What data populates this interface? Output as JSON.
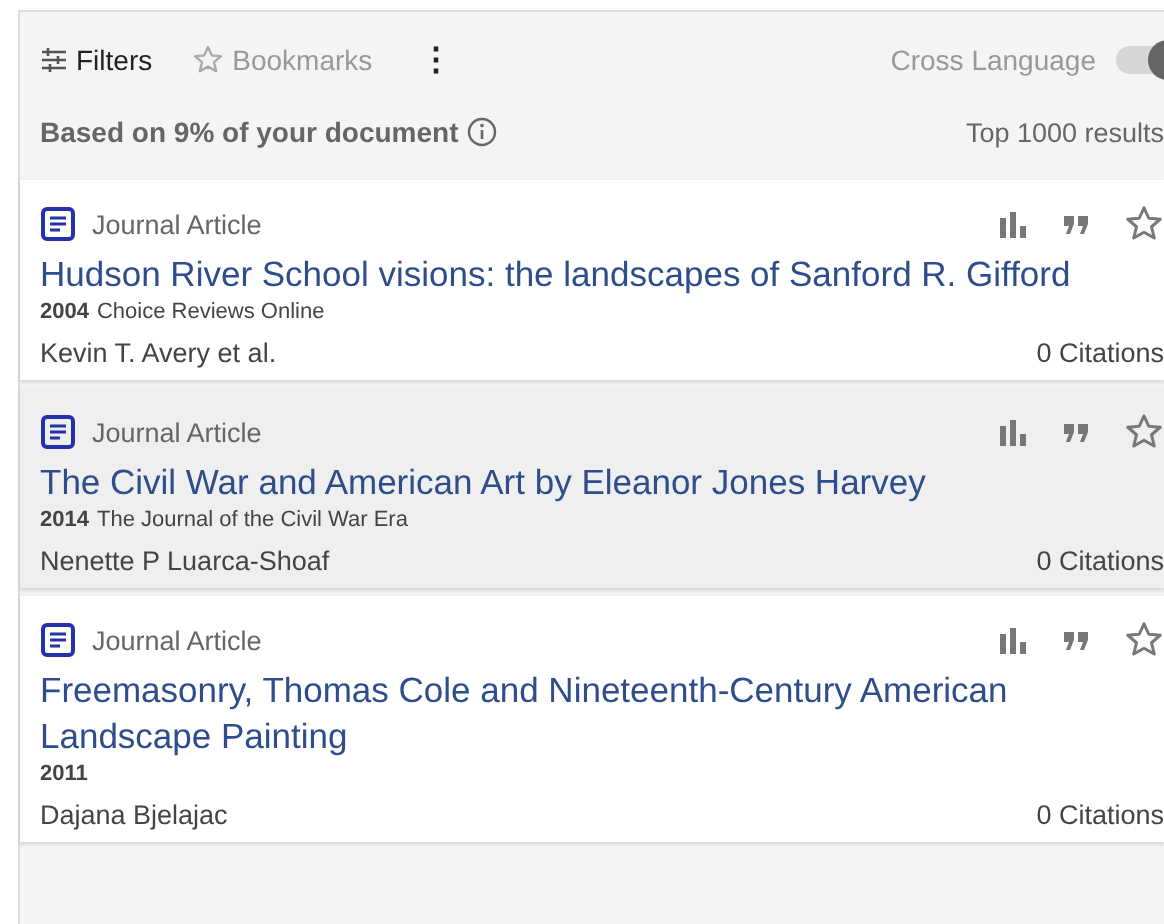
{
  "toolbar": {
    "filters": "Filters",
    "bookmarks": "Bookmarks",
    "more": "⋮",
    "cross_language": {
      "label": "Cross Language",
      "on": true
    }
  },
  "summary": {
    "basis": "Based on 9% of your document",
    "count": "Top 1000 results"
  },
  "results": [
    {
      "type": "Journal Article",
      "title": "Hudson River School visions: the landscapes of Sanford R. Gifford",
      "year": "2004",
      "source": "Choice Reviews Online",
      "authors": "Kevin T. Avery et al.",
      "citations": "0 Citations",
      "selected": false
    },
    {
      "type": "Journal Article",
      "title": "The Civil War and American Art by Eleanor Jones Harvey",
      "year": "2014",
      "source": "The Journal of the Civil War Era",
      "authors": "Nenette P Luarca-Shoaf",
      "citations": "0 Citations",
      "selected": true
    },
    {
      "type": "Journal Article",
      "title": "Freemasonry, Thomas Cole and Nineteenth-Century American Landscape Painting",
      "year": "2011",
      "authors": "Dajana Bjelajac",
      "citations": "0 Citations",
      "selected": false
    }
  ]
}
